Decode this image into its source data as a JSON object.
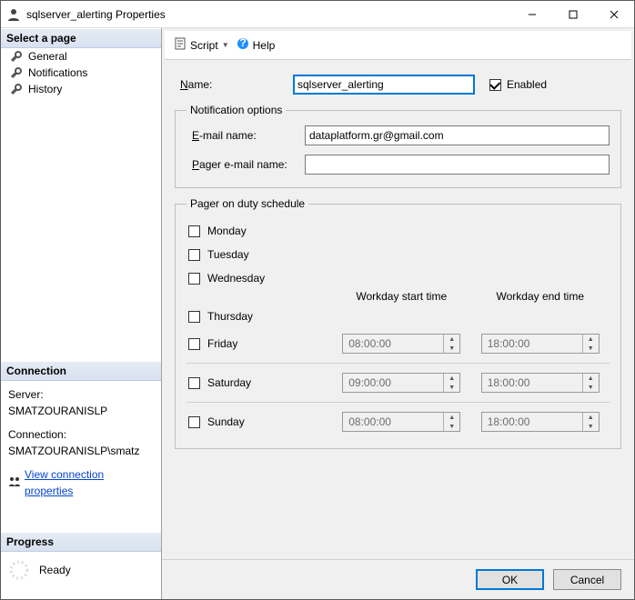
{
  "window": {
    "title": "sqlserver_alerting Properties"
  },
  "titlebar_icons": {
    "min": "—",
    "max": "☐",
    "close": "✕"
  },
  "sidebar": {
    "select_page": "Select a page",
    "items": [
      {
        "label": "General",
        "icon": "wrench-icon"
      },
      {
        "label": "Notifications",
        "icon": "wrench-icon"
      },
      {
        "label": "History",
        "icon": "wrench-icon"
      }
    ],
    "connection_header": "Connection",
    "server_label": "Server:",
    "server_value": "SMATZOURANISLP",
    "connection_label": "Connection:",
    "connection_value": "SMATZOURANISLP\\smatz",
    "view_props": "View connection properties",
    "progress_header": "Progress",
    "progress_status": "Ready"
  },
  "toolbar": {
    "script": "Script",
    "help": "Help"
  },
  "form": {
    "name_label": "Name:",
    "name_value": "sqlserver_alerting",
    "enabled_label": "Enabled",
    "enabled_checked": true,
    "notification_options": "Notification options",
    "email_label": "E-mail name:",
    "email_value": "dataplatform.gr@gmail.com",
    "pager_email_label": "Pager e-mail name:",
    "pager_email_value": "",
    "pager_schedule": "Pager on duty schedule",
    "workday_start": "Workday start time",
    "workday_end": "Workday end time",
    "days": [
      {
        "label": "Monday",
        "hotkey": "M",
        "checked": false
      },
      {
        "label": "Tuesday",
        "hotkey": "T",
        "checked": false
      },
      {
        "label": "Wednesday",
        "hotkey": "W",
        "checked": false
      },
      {
        "label": "Thursday",
        "hotkey": "h",
        "checked": false
      },
      {
        "label": "Friday",
        "hotkey": "F",
        "checked": false,
        "start": "08:00:00",
        "end": "18:00:00",
        "disabled": true
      },
      {
        "label": "Saturday",
        "hotkey": "S",
        "checked": false,
        "start": "09:00:00",
        "end": "18:00:00",
        "disabled": true,
        "sep": true
      },
      {
        "label": "Sunday",
        "hotkey": "u",
        "checked": false,
        "start": "08:00:00",
        "end": "18:00:00",
        "disabled": true,
        "sep": true
      }
    ]
  },
  "buttons": {
    "ok": "OK",
    "cancel": "Cancel"
  }
}
